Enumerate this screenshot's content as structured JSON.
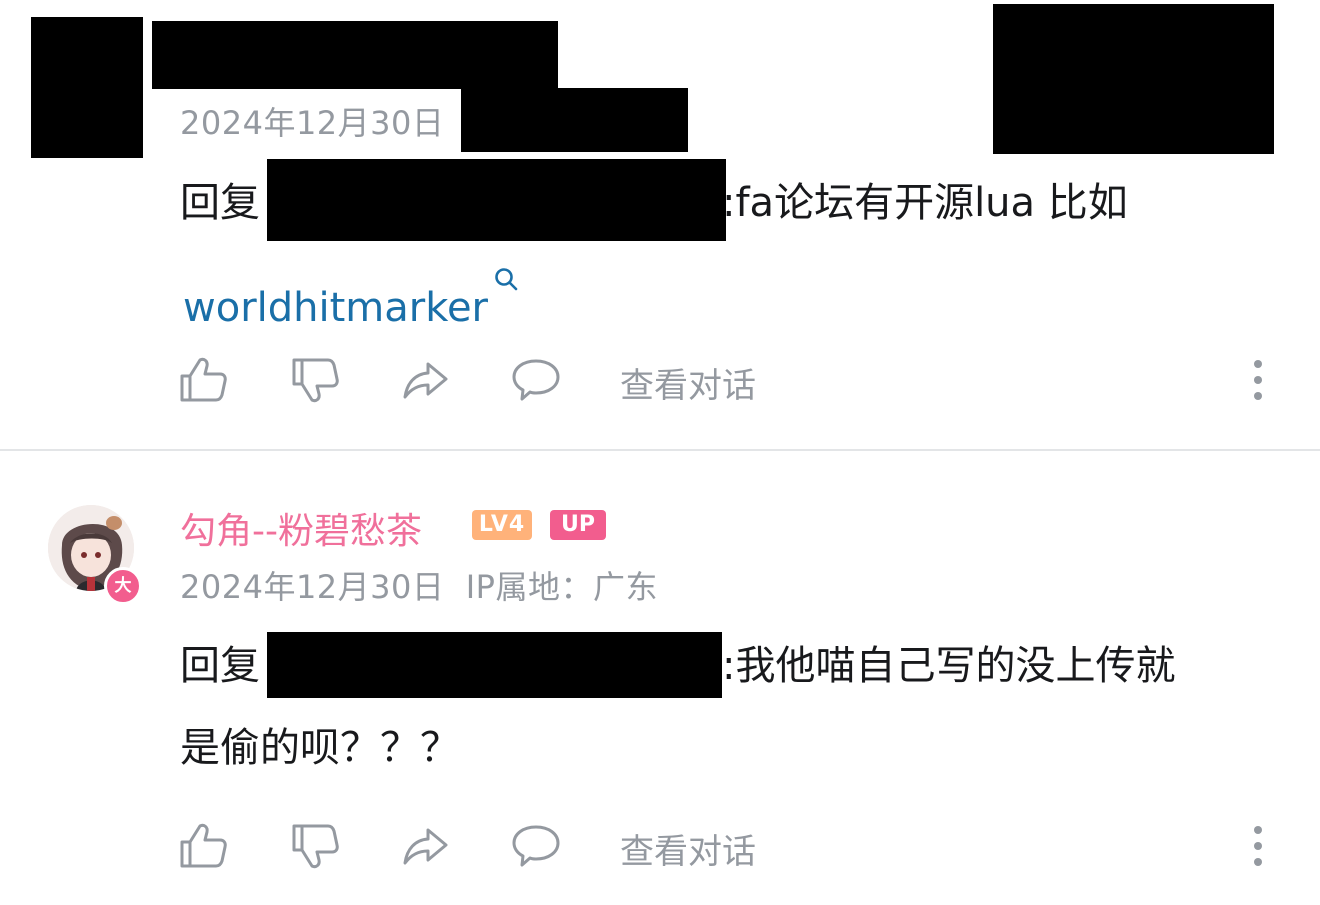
{
  "comments": [
    {
      "date": "2024年12月30日",
      "reply_prefix": "回复",
      "reply_body": ":fa论坛有开源lua 比如",
      "link_text": "worldhitmarker"
    },
    {
      "username": "勾角--粉碧愁茶",
      "level_badge": "LV4",
      "up_badge": "UP",
      "avatar_badge": "大",
      "date_ip": "2024年12月30日  IP属地：广东",
      "reply_prefix": "回复",
      "reply_body_line1": ":我他喵自己写的没上传就",
      "reply_body_line2": "是偷的呗？？？"
    }
  ],
  "actions": {
    "view_dialog": "查看对话"
  },
  "icons": [
    "thumb-up-icon",
    "thumb-down-icon",
    "share-icon",
    "comment-icon",
    "more-vertical-icon",
    "search-icon"
  ],
  "colors": {
    "username": "#f0709b",
    "link": "#1a6fa8",
    "meta_text": "#9499a0",
    "lv_badge": "#ffb27a",
    "up_badge": "#f25d8e"
  }
}
